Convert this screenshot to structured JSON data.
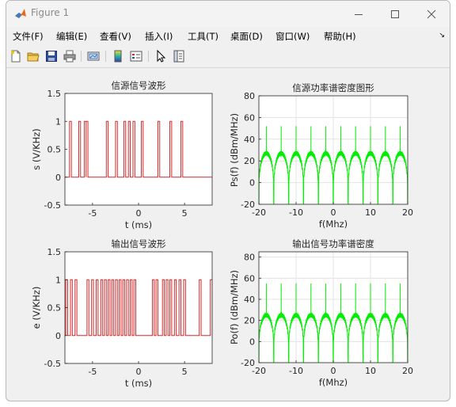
{
  "window": {
    "title": "Figure 1",
    "controls": {
      "minimize": "minimize",
      "maximize": "maximize",
      "close": "close"
    }
  },
  "menubar": {
    "items": [
      {
        "label": "文件(F)"
      },
      {
        "label": "编辑(E)"
      },
      {
        "label": "查看(V)"
      },
      {
        "label": "插入(I)"
      },
      {
        "label": "工具(T)"
      },
      {
        "label": "桌面(D)"
      },
      {
        "label": "窗口(W)"
      },
      {
        "label": "帮助(H)"
      }
    ]
  },
  "toolbar": {
    "buttons": [
      "new-figure",
      "open-file",
      "save",
      "print",
      "link-plot",
      "insert-colorbar",
      "insert-legend",
      "edit-plot",
      "property-inspector"
    ]
  },
  "colors": {
    "time_signal": "#d62728",
    "spectrum": "#00ee00"
  },
  "chart_data": [
    {
      "type": "line",
      "title": "信源信号波形",
      "xlabel": "t (ms)",
      "ylabel": "s  (V/KHz)",
      "xlim": [
        -8,
        8
      ],
      "ylim": [
        -0.5,
        1.5
      ],
      "xticks": [
        -5,
        0,
        5
      ],
      "yticks": [
        -0.5,
        0,
        0.5,
        1,
        1.5
      ],
      "grid": false,
      "series": [
        {
          "pulses": [
            [
              -7.5,
              -7.3
            ],
            [
              -6.5,
              -6.3
            ],
            [
              -5.9,
              -5.7
            ],
            [
              -5.7,
              -5.5
            ],
            [
              -3.5,
              -3.3
            ],
            [
              -2.5,
              -2.3
            ],
            [
              -1.6,
              -1.4
            ],
            [
              -1.1,
              -0.9
            ],
            [
              -0.6,
              -0.4
            ],
            [
              0.3,
              0.5
            ],
            [
              2.1,
              2.3
            ],
            [
              3.4,
              3.6
            ],
            [
              4.6,
              4.8
            ]
          ]
        }
      ]
    },
    {
      "type": "line",
      "title": "信源功率谱密度图形",
      "xlabel": "f(Mhz)",
      "ylabel": "Ps(f) (dBm/MHz)",
      "xlim": [
        -20,
        20
      ],
      "ylim": [
        -20,
        80
      ],
      "xticks": [
        -20,
        -10,
        0,
        10,
        20
      ],
      "yticks": [
        -20,
        0,
        20,
        40,
        60,
        80
      ],
      "grid": true,
      "series": [
        {
          "lobe_spacing": 4,
          "peak_level": 27,
          "spur_level": 52
        }
      ]
    },
    {
      "type": "line",
      "title": "输出信号波形",
      "xlabel": "t (ms)",
      "ylabel": "e  (V/KHz)",
      "xlim": [
        -8,
        8
      ],
      "ylim": [
        -0.5,
        1.5
      ],
      "xticks": [
        -5,
        0,
        5
      ],
      "yticks": [
        -0.5,
        0,
        0.5,
        1,
        1.5
      ],
      "grid": false,
      "series": [
        {
          "pulses": [
            [
              -7.9,
              -7.7
            ],
            [
              -7.4,
              -7.2
            ],
            [
              -6.9,
              -6.7
            ],
            [
              -5.6,
              -5.4
            ],
            [
              -5.1,
              -4.9
            ],
            [
              -4.6,
              -4.4
            ],
            [
              -4.1,
              -3.9
            ],
            [
              -3.7,
              -3.5
            ],
            [
              -3.3,
              -3.1
            ],
            [
              -2.9,
              -2.7
            ],
            [
              -2.5,
              -2.3
            ],
            [
              -2.1,
              -1.9
            ],
            [
              -1.7,
              -1.5
            ],
            [
              -1.3,
              -1.1
            ],
            [
              -0.9,
              -0.7
            ],
            [
              -0.5,
              -0.3
            ],
            [
              1.5,
              1.7
            ],
            [
              1.9,
              2.1
            ],
            [
              2.6,
              2.8
            ],
            [
              3.0,
              3.2
            ],
            [
              3.4,
              3.6
            ],
            [
              3.9,
              4.1
            ],
            [
              4.4,
              4.6
            ],
            [
              4.9,
              5.1
            ],
            [
              6.6,
              6.8
            ],
            [
              7.8,
              8.0
            ]
          ]
        }
      ]
    },
    {
      "type": "line",
      "title": "输出信号功率谱密度",
      "xlabel": "f(Mhz)",
      "ylabel": "Po(f) (dBm/MHz)",
      "xlim": [
        -20,
        20
      ],
      "ylim": [
        -20,
        85
      ],
      "xticks": [
        -20,
        -10,
        0,
        10,
        20
      ],
      "yticks": [
        -20,
        0,
        20,
        40,
        60,
        80
      ],
      "grid": true,
      "series": [
        {
          "lobe_spacing": 4,
          "peak_level": 25,
          "spur_level": 55
        }
      ]
    }
  ]
}
